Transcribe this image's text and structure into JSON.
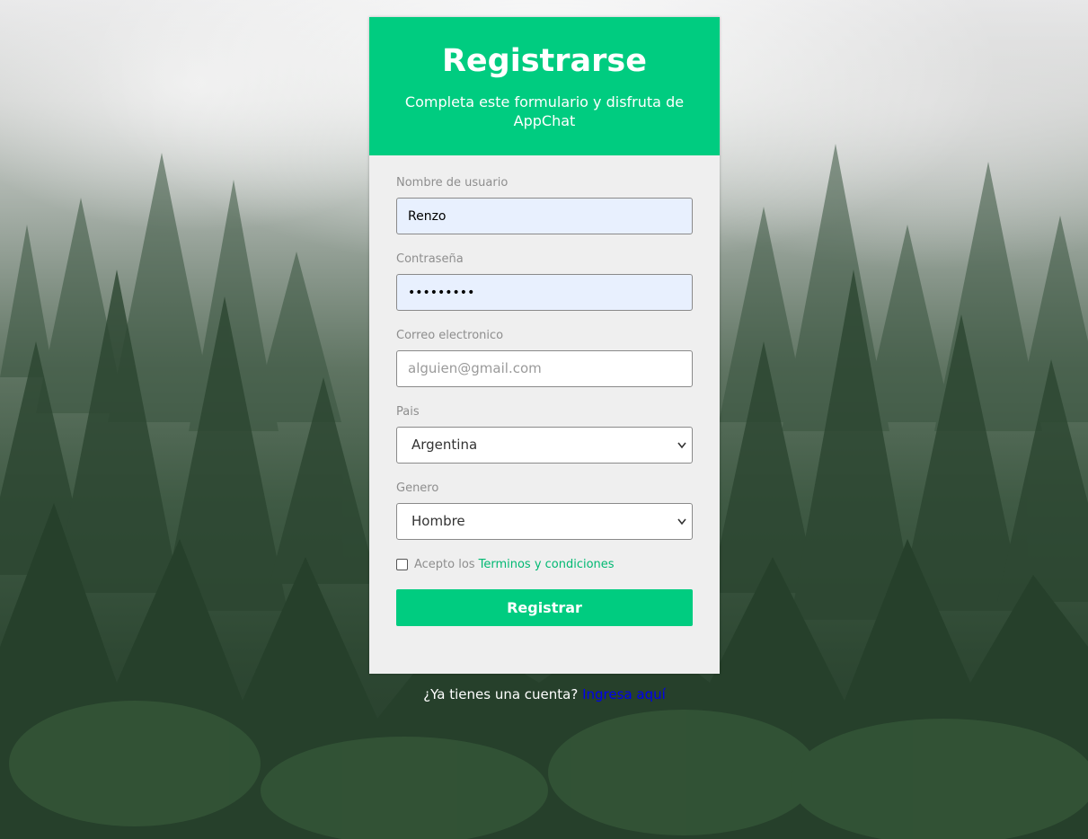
{
  "header": {
    "title": "Registrarse",
    "subtitle": "Completa este formulario y disfruta de AppChat"
  },
  "form": {
    "username": {
      "label": "Nombre de usuario",
      "value": "Renzo"
    },
    "password": {
      "label": "Contraseña",
      "value": "•••••••••"
    },
    "email": {
      "label": "Correo electronico",
      "value": "",
      "placeholder": "alguien@gmail.com"
    },
    "country": {
      "label": "Pais",
      "selected": "Argentina"
    },
    "gender": {
      "label": "Genero",
      "selected": "Hombre"
    },
    "terms": {
      "prefix": "Acepto los",
      "link": "Terminos y condiciones",
      "checked": false
    },
    "submit_label": "Registrar"
  },
  "footer": {
    "question": "¿Ya tienes una cuenta?",
    "link": "Ingresa aquí"
  },
  "colors": {
    "accent": "#00cc80",
    "card_background": "#efefef",
    "autofill_background": "#e8f0fe",
    "link_blue": "#0000ee"
  },
  "background": {
    "subject": "misty pine forest"
  }
}
